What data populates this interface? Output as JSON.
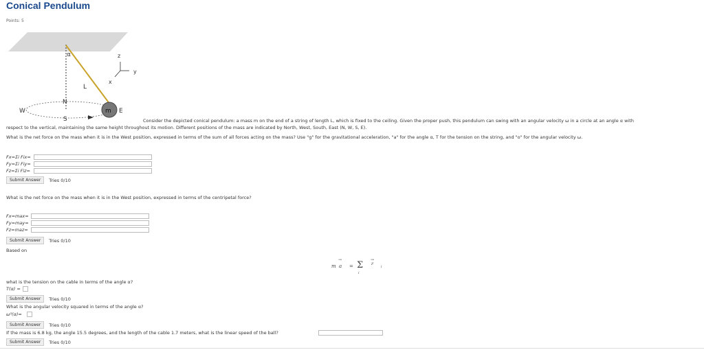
{
  "title": "Conical Pendulum",
  "points": "Points: 5",
  "diagram": {
    "alpha": "α",
    "z": "z",
    "y": "y",
    "x": "x",
    "L": "L",
    "N": "N",
    "S": "S",
    "W": "W",
    "E": "E",
    "m": "m"
  },
  "intro_line1": "Consider the depicted conical pendulum: a mass m on the end of a string of length L, which is fixed to the ceiling. Given the proper push, this pendulum can swing with an angular velocity ω in a circle at an angle α with",
  "intro_line2": "respect to the vertical, maintaining the same height throughout its motion. Different positions of the mass are indicated by North, West, South, East (N, W, S, E).",
  "question1": "What is the net force on the mass when it is in the West position, expressed in terms of the sum of all forces acting on the mass? Use \"g\" for the gravitational acceleration, \"a\" for the angle α, T for the tension on the string, and \"o\" for the angular velocity ω.",
  "q1_fields": [
    {
      "label": "Fx=Σi Fix=",
      "value": ""
    },
    {
      "label": "Fy=Σi Fiy=",
      "value": ""
    },
    {
      "label": "Fz=Σi Fiz=",
      "value": ""
    }
  ],
  "submit_label": "Submit Answer",
  "tries": "Tries 0/10",
  "question2": "What is the net force on the mass when it is in the West position, expressed in terms of the centripetal force?",
  "q2_fields": [
    {
      "label": "Fx=max=",
      "value": ""
    },
    {
      "label": "Fy=may=",
      "value": ""
    },
    {
      "label": "Fz=maz=",
      "value": ""
    }
  ],
  "based_on": "Based on",
  "equation": {
    "m": "m",
    "a": "a",
    "eq": "=",
    "sigma": "Σ",
    "F": "F",
    "i": "i",
    "sub_i": "i"
  },
  "question3": "what is the tension on the cable in terms of the angle α?",
  "q3_label": "T(α) =",
  "question4": "What is the angular velocity squared in terms of the angle α?",
  "q4_label": "ω²(α)=",
  "question5": "If the mass is 6.8 kg, the angle 15.5 degrees, and the length of the cable 1.7 meters, what is the linear speed of the ball?"
}
